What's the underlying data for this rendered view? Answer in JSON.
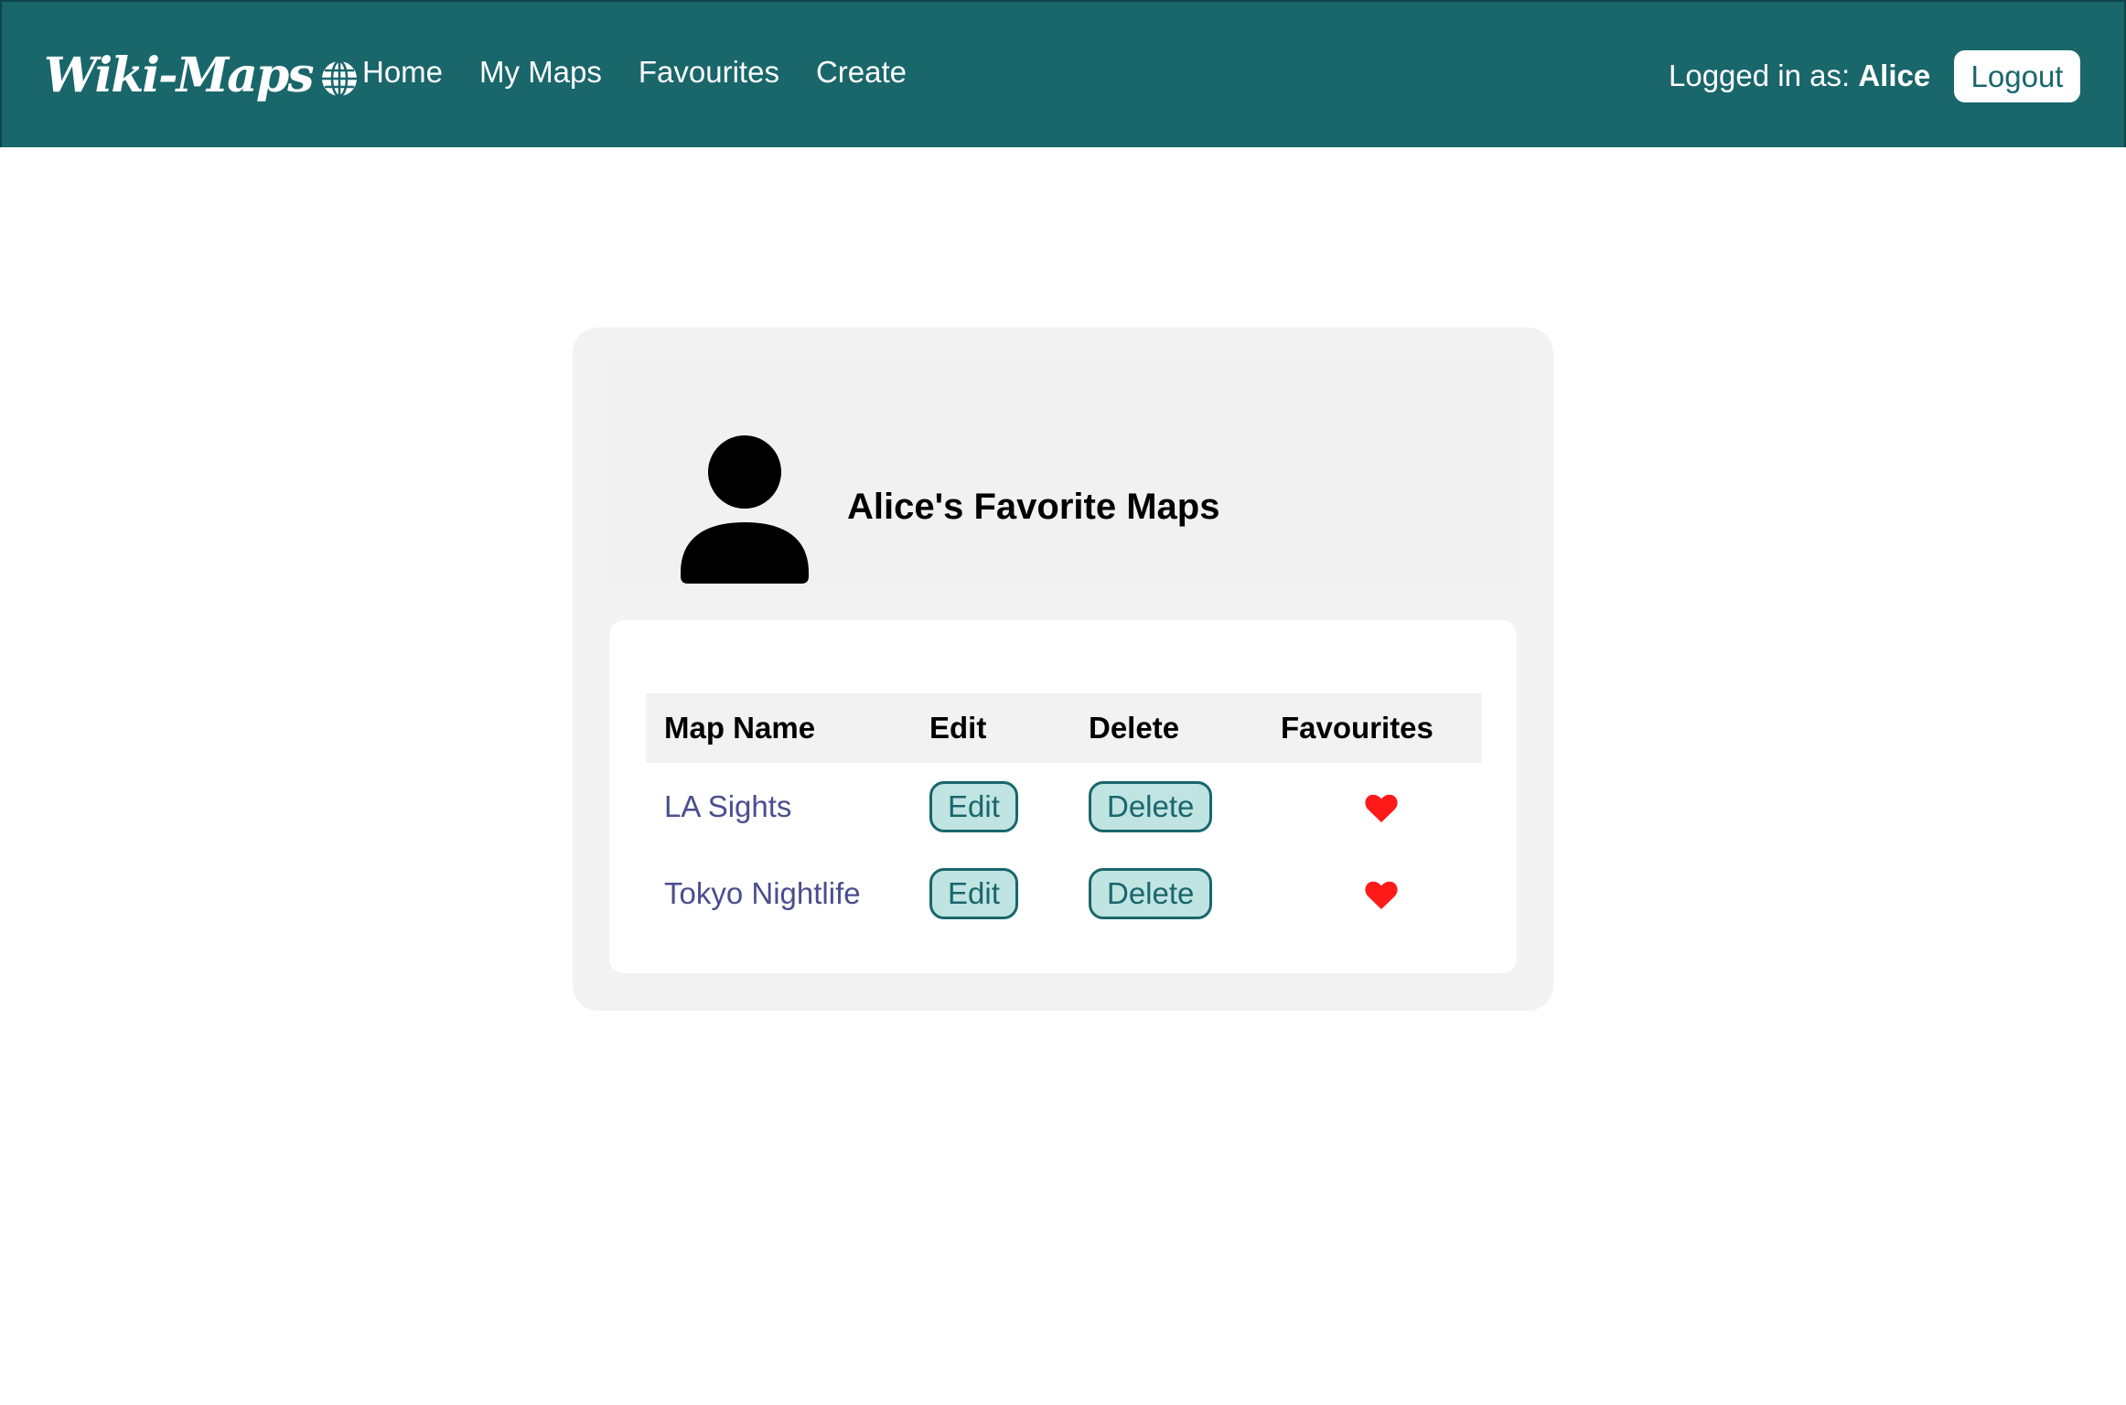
{
  "navbar": {
    "brand": "Wiki-Maps",
    "brand_icon": "globe-icon",
    "links": [
      {
        "label": "Home"
      },
      {
        "label": "My Maps"
      },
      {
        "label": "Favourites"
      },
      {
        "label": "Create"
      }
    ],
    "logged_in_prefix": "Logged in as:",
    "username": "Alice",
    "logout_label": "Logout"
  },
  "profile": {
    "avatar_icon": "user-avatar-icon",
    "title": "Alice's Favorite Maps"
  },
  "table": {
    "headers": [
      "Map Name",
      "Edit",
      "Delete",
      "Favourites"
    ],
    "rows": [
      {
        "name": "LA Sights",
        "edit": "Edit",
        "delete": "Delete",
        "favourite_icon": "heart-icon"
      },
      {
        "name": "Tokyo Nightlife",
        "edit": "Edit",
        "delete": "Delete",
        "favourite_icon": "heart-icon"
      }
    ]
  },
  "colors": {
    "navbar_bg": "#19666b",
    "button_bg": "#bfe4e2",
    "link_color": "#4a4e8e",
    "heart": "#ff1a1a"
  }
}
